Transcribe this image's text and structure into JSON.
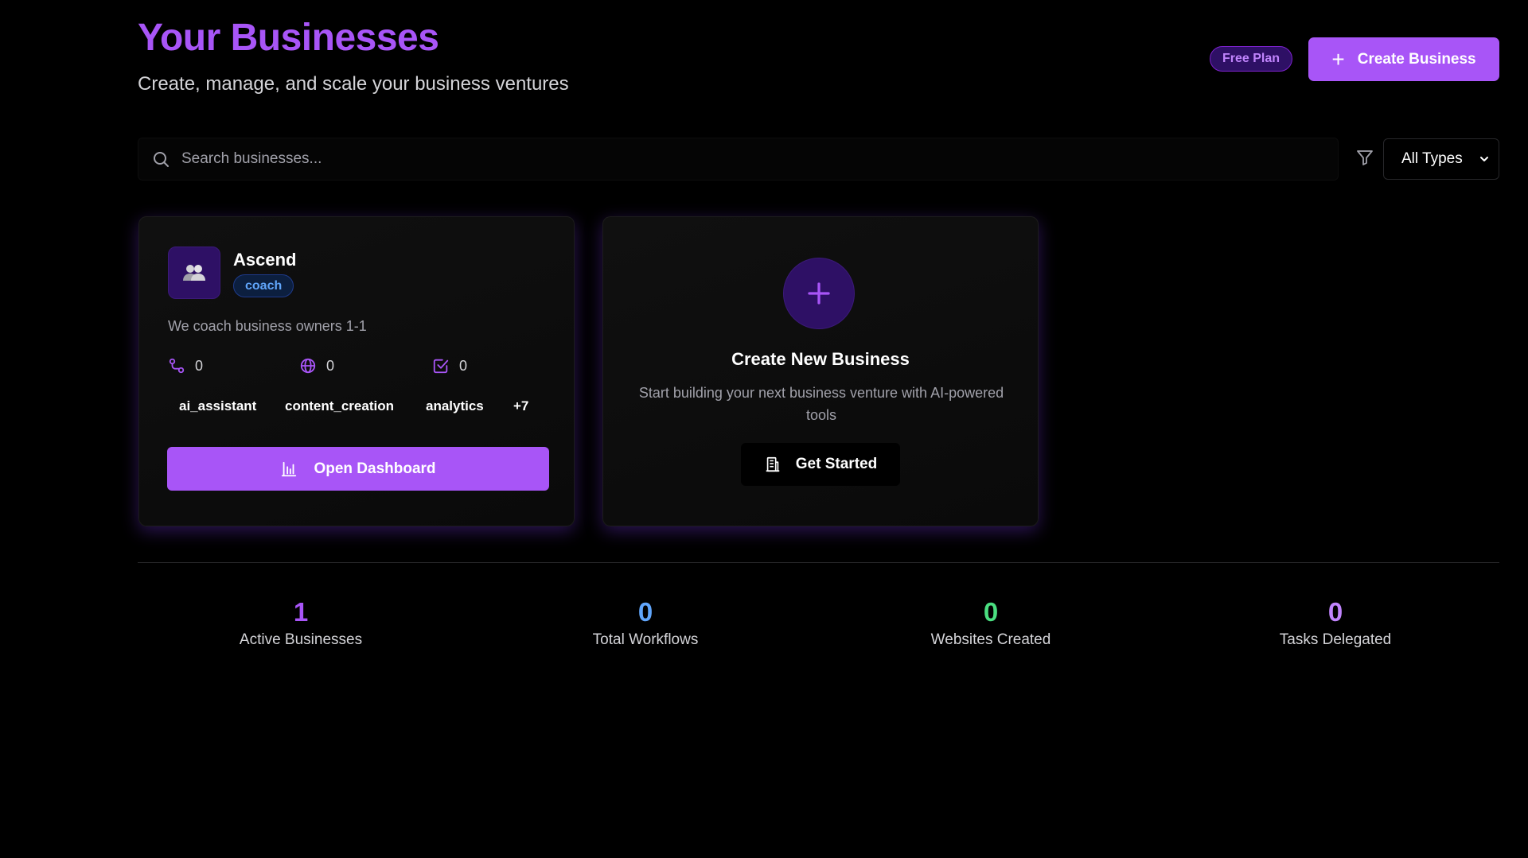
{
  "header": {
    "title": "Your Businesses",
    "subtitle": "Create, manage, and scale your business ventures",
    "plan_badge": "Free Plan",
    "create_button": "Create Business"
  },
  "search": {
    "placeholder": "Search businesses...",
    "filter_value": "All Types"
  },
  "business_card": {
    "name": "Ascend",
    "tag": "coach",
    "description": "We coach business owners 1-1",
    "stats": [
      {
        "icon": "workflow-icon",
        "value": "0"
      },
      {
        "icon": "globe-icon",
        "value": "0"
      },
      {
        "icon": "task-check-icon",
        "value": "0"
      }
    ],
    "capabilities": [
      "ai_assistant",
      "content_creation",
      "analytics",
      "+7"
    ],
    "open_button": "Open Dashboard"
  },
  "create_card": {
    "title": "Create New Business",
    "description": "Start building your next business venture with AI-powered tools",
    "button": "Get Started"
  },
  "summary": [
    {
      "value": "1",
      "label": "Active Businesses",
      "color": "#a855f7"
    },
    {
      "value": "0",
      "label": "Total Workflows",
      "color": "#60a5fa"
    },
    {
      "value": "0",
      "label": "Websites Created",
      "color": "#4ade80"
    },
    {
      "value": "0",
      "label": "Tasks Delegated",
      "color": "#c084fc"
    }
  ],
  "colors": {
    "accent": "#a855f7",
    "background": "#000000"
  }
}
